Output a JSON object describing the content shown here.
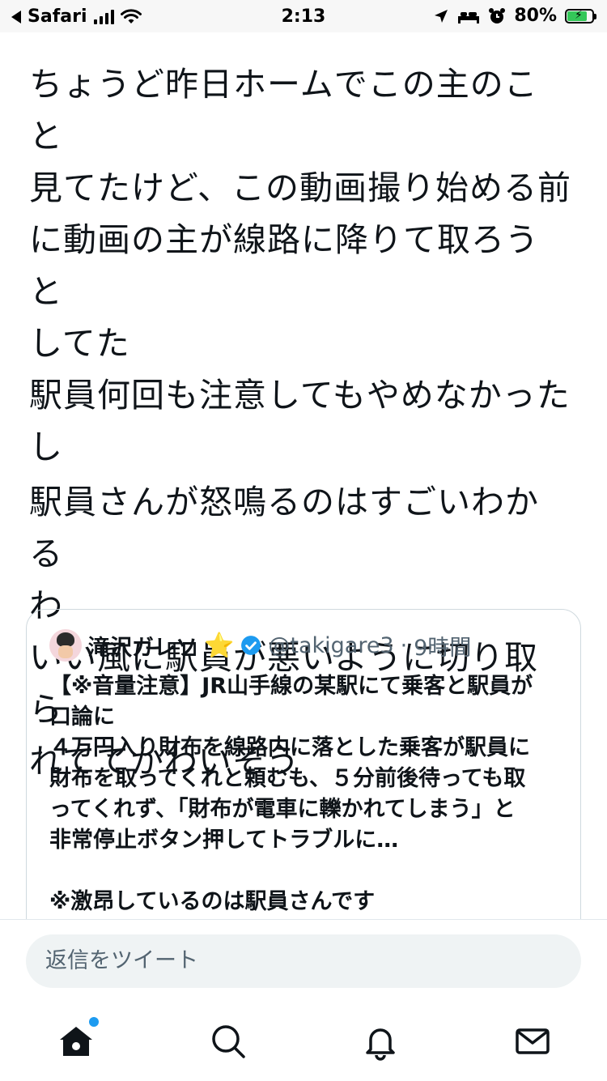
{
  "status_bar": {
    "back_app": "Safari",
    "time": "2:13",
    "battery_percent": "80%",
    "battery_level": 0.8
  },
  "tweet": {
    "paragraphs": [
      "ちょうど昨日ホームでこの主のこと\n見てたけど、この動画撮り始める前\nに動画の主が線路に降りて取ろうと\nしてた\n駅員何回も注意してもやめなかった\nし",
      "駅員さんが怒鳴るのはすごいわかる\nわ\nいい風に駅員が悪いように切り取ら\nれててかわいそう"
    ]
  },
  "quote": {
    "name": "滝沢ガレソ",
    "star": "⭐",
    "handle": "@takigare3",
    "separator": "·",
    "time": "9時間",
    "body": "【※音量注意】JR山手線の某駅にて乗客と駅員が\n口論に\n４万円入り財布を線路内に落とした乗客が駅員に\n財布を取ってくれと頼むも、５分前後待っても取\nってくれず、「財布が電車に轢かれてしまう」と\n非常停止ボタン押してトラブルに…\n\n※激昂しているのは駅員さんです"
  },
  "reply": {
    "placeholder": "返信をツイート"
  },
  "tabbar": {
    "items": [
      "home-icon",
      "search-icon",
      "notifications-icon",
      "messages-icon"
    ],
    "home_has_notification_dot": true
  },
  "colors": {
    "accent": "#1d9bf0",
    "text": "#0f1419",
    "secondary": "#536471",
    "border": "#cfd9de",
    "input_bg": "#eff3f4"
  }
}
